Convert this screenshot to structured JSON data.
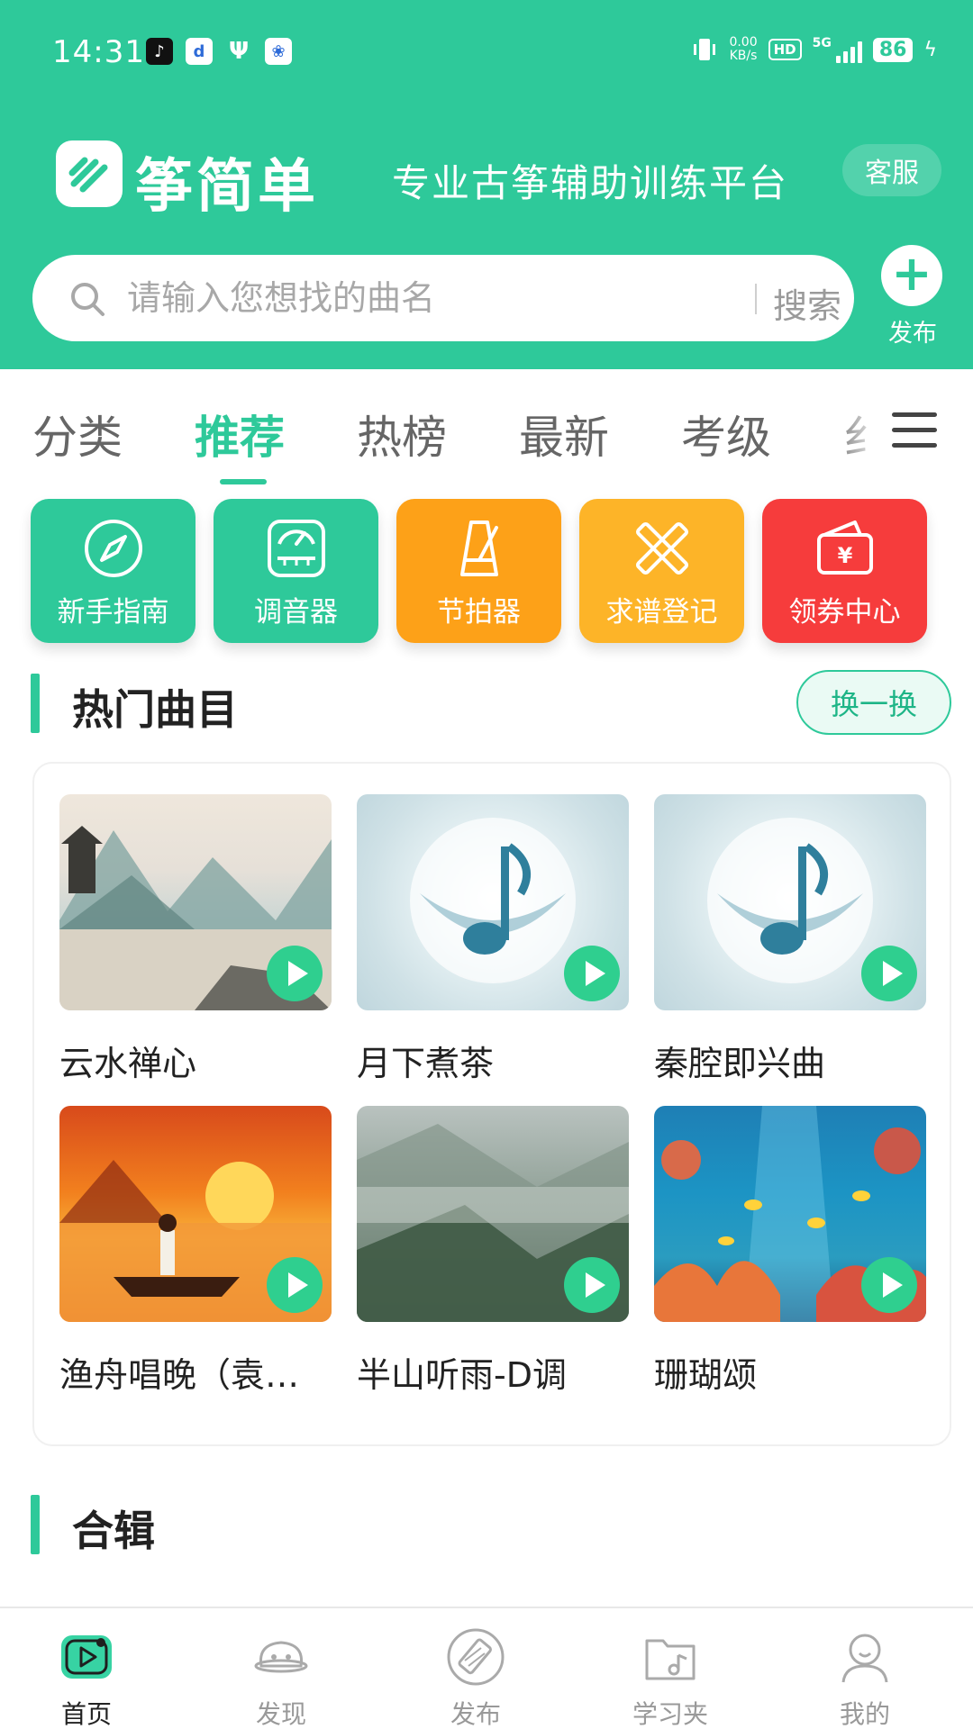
{
  "status_bar": {
    "time": "14:31",
    "app_icons": [
      "tiktok-icon",
      "weather-app-icon",
      "usb-icon",
      "baidu-icon"
    ],
    "net_speed_value": "0.00",
    "net_speed_unit": "KB/s",
    "hd_label": "HD",
    "signal_label": "5G",
    "battery": "86"
  },
  "header": {
    "app_name": "筝简单",
    "slogan": "专业古筝辅助训练平台",
    "service_label": "客服",
    "search_placeholder": "请输入您想找的曲名",
    "search_button": "搜索",
    "publish_label": "发布"
  },
  "tabs": [
    {
      "label": "分类",
      "active": false
    },
    {
      "label": "推荐",
      "active": true
    },
    {
      "label": "热榜",
      "active": false
    },
    {
      "label": "最新",
      "active": false
    },
    {
      "label": "考级",
      "active": false
    },
    {
      "label": "纟",
      "active": false
    }
  ],
  "shortcuts": [
    {
      "label": "新手指南",
      "icon": "compass-icon",
      "color": "#2ec99a"
    },
    {
      "label": "调音器",
      "icon": "tuner-icon",
      "color": "#2ec99a"
    },
    {
      "label": "节拍器",
      "icon": "metronome-icon",
      "color": "#fda118"
    },
    {
      "label": "求谱登记",
      "icon": "pencil-ruler-icon",
      "color": "#fdb428"
    },
    {
      "label": "领券中心",
      "icon": "coupon-wallet-icon",
      "color": "#f63c3c"
    }
  ],
  "hot_section": {
    "title": "热门曲目",
    "refresh_label": "换一换",
    "songs": [
      {
        "title": "云水禅心"
      },
      {
        "title": "月下煮茶"
      },
      {
        "title": "秦腔即兴曲"
      },
      {
        "title": "渔舟唱晚（袁…"
      },
      {
        "title": "半山听雨-D调"
      },
      {
        "title": "珊瑚颂"
      }
    ]
  },
  "album_section": {
    "title": "合辑"
  },
  "bottom_nav": [
    {
      "label": "首页",
      "icon": "home-play-icon",
      "active": true
    },
    {
      "label": "发现",
      "icon": "discover-icon",
      "active": false
    },
    {
      "label": "发布",
      "icon": "publish-icon",
      "active": false
    },
    {
      "label": "学习夹",
      "icon": "folder-music-icon",
      "active": false
    },
    {
      "label": "我的",
      "icon": "profile-icon",
      "active": false
    }
  ],
  "colors": {
    "brand": "#2ec99a",
    "orange": "#fda118",
    "yellow": "#fdb428",
    "red": "#f63c3c"
  }
}
